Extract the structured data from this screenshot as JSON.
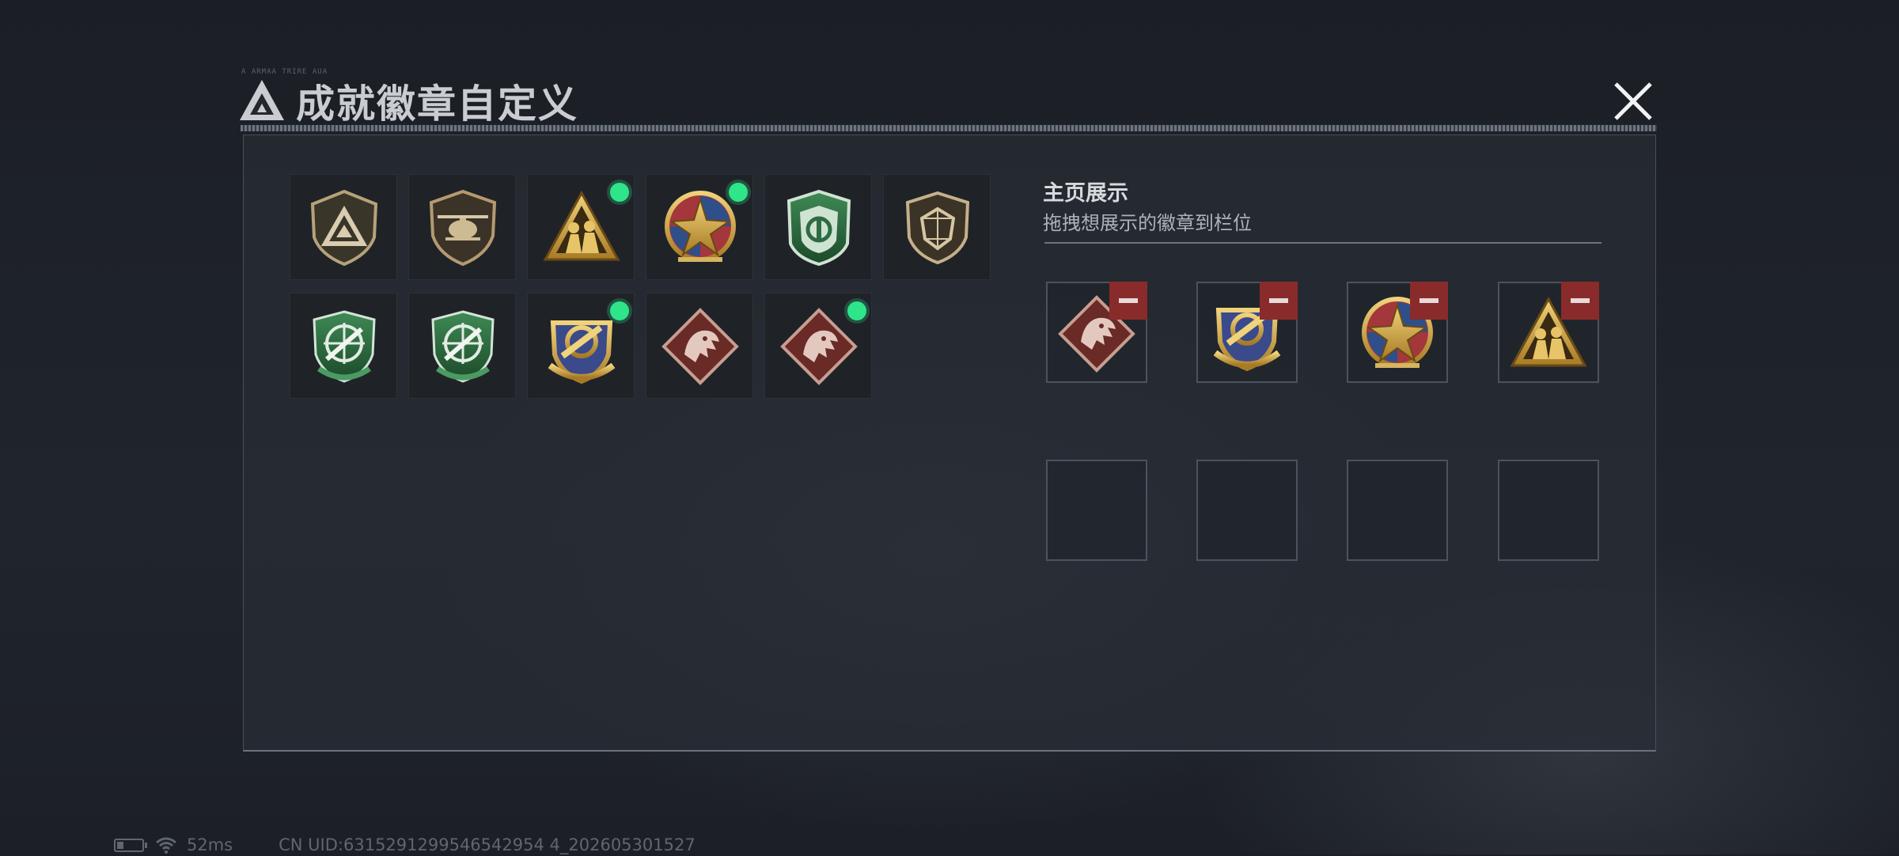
{
  "dialog": {
    "title": "成就徽章自定义",
    "header_code": "A ARMAA TRIRE AUA"
  },
  "inventory": {
    "badges": [
      {
        "name": "triangle-shield-badge",
        "new": false
      },
      {
        "name": "helicopter-shield-badge",
        "new": false
      },
      {
        "name": "soldiers-triangle-badge",
        "new": true
      },
      {
        "name": "compass-star-badge",
        "new": true
      },
      {
        "name": "green-crest-badge",
        "new": false
      },
      {
        "name": "dark-gem-shield-badge",
        "new": false
      },
      {
        "name": "green-rifle-badge",
        "new": false
      },
      {
        "name": "green-rifle-badge-2",
        "new": false
      },
      {
        "name": "gold-ring-badge",
        "new": true
      },
      {
        "name": "dragon-diamond-badge",
        "new": false
      },
      {
        "name": "dragon-diamond-badge-2",
        "new": true
      }
    ]
  },
  "showcase": {
    "title": "主页展示",
    "subtitle": "拖拽想展示的徽章到栏位",
    "slots": [
      {
        "badge": "dragon-diamond-badge",
        "filled": true
      },
      {
        "badge": "gold-ring-badge",
        "filled": true
      },
      {
        "badge": "compass-star-badge",
        "filled": true
      },
      {
        "badge": "soldiers-triangle-badge",
        "filled": true
      },
      {
        "badge": "",
        "filled": false
      },
      {
        "badge": "",
        "filled": false
      },
      {
        "badge": "",
        "filled": false
      },
      {
        "badge": "",
        "filled": false
      }
    ]
  },
  "status_bar": {
    "ping": "52ms",
    "uid": "CN UID:6315291299546542954 4_202605301527"
  },
  "colors": {
    "new_indicator": "#2ee58a",
    "remove_button": "#8a2b2b",
    "panel_border": "#4a5059"
  }
}
